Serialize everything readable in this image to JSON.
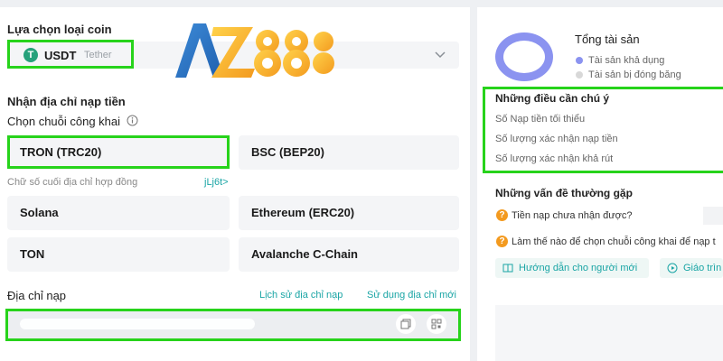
{
  "left": {
    "coin_section_title": "Lựa chọn loại coin",
    "selected_coin": {
      "code": "USDT",
      "name": "Tether",
      "logo_glyph": "T"
    },
    "logo_text": "AZ888",
    "deposit_title": "Nhận địa chỉ nạp tiền",
    "chain_label": "Chọn chuỗi công khai",
    "chains": [
      "TRON (TRC20)",
      "BSC (BEP20)",
      "Solana",
      "Ethereum (ERC20)",
      "TON",
      "Avalanche C-Chain"
    ],
    "contract_hint": "Chữ số cuối địa chỉ hợp đồng",
    "contract_suffix": "jLj6t>",
    "address_label": "Địa chỉ nạp",
    "address_history_link": "Lịch sử địa chỉ nạp",
    "use_address_link": "Sử dụng địa chỉ mới",
    "address_value": ""
  },
  "right": {
    "assets_title": "Tổng tài sản",
    "legend": [
      {
        "label": "Tài sản khả dụng",
        "color": "#8b93f0"
      },
      {
        "label": "Tài sản bị đóng băng",
        "color": "#d8d8d8"
      }
    ],
    "notes_title": "Những điều cần chú ý",
    "notes": [
      "Số Nạp tiền tối thiểu",
      "Số lượng xác nhận nạp tiền",
      "Số lượng xác nhận khả rút"
    ],
    "faq_title": "Những vấn đề thường gặp",
    "faq": [
      "Tiền nạp chưa nhận được?",
      "Làm thế nào để chọn chuỗi công khai để nạp t"
    ],
    "guide_buttons": [
      "Hướng dẫn cho người mới",
      "Giáo trìn"
    ]
  },
  "colors": {
    "highlight": "#27d31b",
    "accent": "#1aa5a5",
    "tether": "#26a17b",
    "donut": "#8b93f0"
  }
}
